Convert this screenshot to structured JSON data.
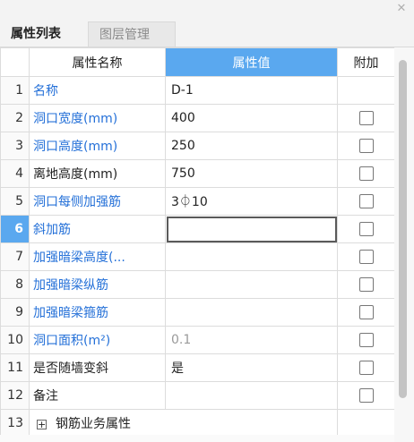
{
  "tabs": [
    {
      "label": "属性列表",
      "active": true
    },
    {
      "label": "图层管理",
      "active": false
    }
  ],
  "close_icon": "close-icon",
  "headers": {
    "name": "属性名称",
    "value": "属性值",
    "extra": "附加"
  },
  "rows": [
    {
      "num": "1",
      "name": "名称",
      "value": "D-1",
      "has_checkbox": false,
      "checked": false
    },
    {
      "num": "2",
      "name": "洞口宽度(mm)",
      "value": "400",
      "has_checkbox": true,
      "checked": false
    },
    {
      "num": "3",
      "name": "洞口高度(mm)",
      "value": "250",
      "has_checkbox": true,
      "checked": false
    },
    {
      "num": "4",
      "name": "离地高度(mm)",
      "value": "750",
      "has_checkbox": true,
      "checked": false
    },
    {
      "num": "5",
      "name": "洞口每侧加强筋",
      "value": "3⏀10",
      "has_checkbox": true,
      "checked": false
    },
    {
      "num": "6",
      "name": "斜加筋",
      "value": "",
      "has_checkbox": true,
      "checked": false
    },
    {
      "num": "7",
      "name": "加强暗梁高度(...",
      "value": "",
      "has_checkbox": true,
      "checked": false
    },
    {
      "num": "8",
      "name": "加强暗梁纵筋",
      "value": "",
      "has_checkbox": true,
      "checked": false
    },
    {
      "num": "9",
      "name": "加强暗梁箍筋",
      "value": "",
      "has_checkbox": true,
      "checked": false
    },
    {
      "num": "10",
      "name": "洞口面积(m²)",
      "value": "0.1",
      "has_checkbox": true,
      "checked": false
    },
    {
      "num": "11",
      "name": "是否随墙变斜",
      "value": "是",
      "has_checkbox": true,
      "checked": false
    },
    {
      "num": "12",
      "name": "备注",
      "value": "",
      "has_checkbox": true,
      "checked": false
    },
    {
      "num": "13",
      "name": "钢筋业务属性",
      "value": "",
      "has_checkbox": false,
      "checked": false,
      "expand_icon": "plus-expand-icon"
    }
  ],
  "selected_row": "6",
  "colors": {
    "accent": "#5aa8ef",
    "link": "#2470d8",
    "gray_value": "#9a9a9a"
  }
}
